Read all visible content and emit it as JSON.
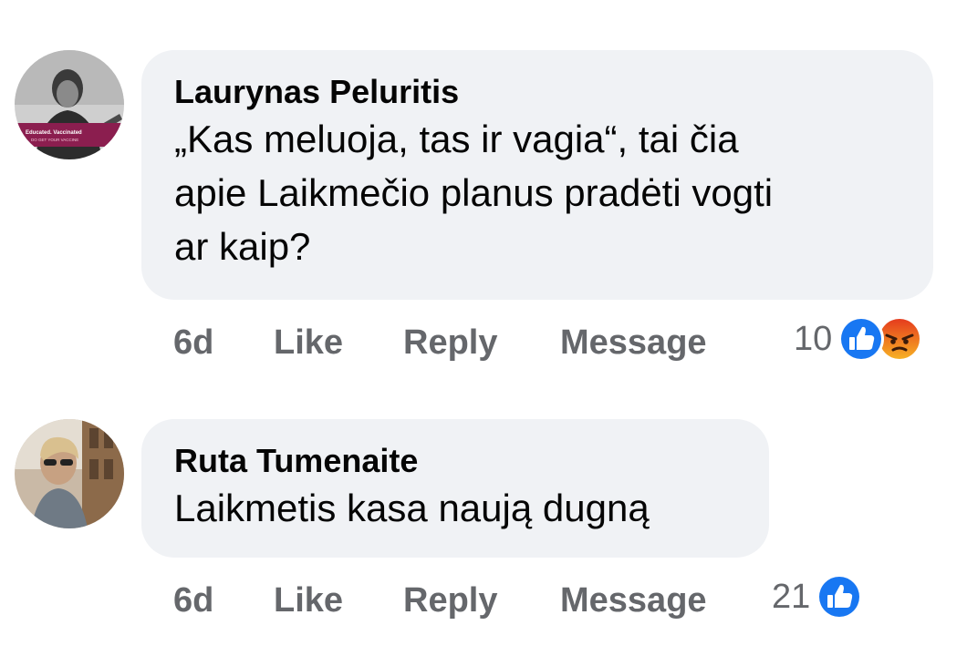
{
  "comments": [
    {
      "author": "Laurynas Peluritis",
      "text": "„Kas meluoja, tas ir vagia“, tai čia\napie Laikmečio planus pradėti vogti\nar kaip?",
      "avatar_badge_line1": "Educated. Vaccinated",
      "avatar_badge_line2": "DO GET YOUR VACCINE",
      "time": "6d",
      "like_label": "Like",
      "reply_label": "Reply",
      "message_label": "Message",
      "reaction_count": "10",
      "reactions": [
        "like-icon",
        "angry-icon"
      ]
    },
    {
      "author": "Ruta Tumenaite",
      "text": "Laikmetis kasa naują dugną",
      "time": "6d",
      "like_label": "Like",
      "reply_label": "Reply",
      "message_label": "Message",
      "reaction_count": "21",
      "reactions": [
        "like-icon"
      ]
    }
  ],
  "colors": {
    "bubble": "#f0f2f5",
    "meta_text": "#65676b",
    "like_blue": "#1877f2",
    "angry_orange": "#f05a1c"
  }
}
